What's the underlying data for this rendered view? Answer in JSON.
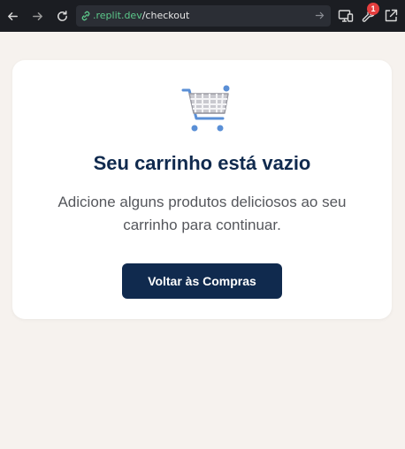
{
  "browser": {
    "url_host": ".replit.dev",
    "url_path": "/checkout",
    "notification_count": "1"
  },
  "cart": {
    "title": "Seu carrinho está vazio",
    "message": "Adicione alguns produtos deliciosos ao seu carrinho para continuar.",
    "button_label": "Voltar às Compras"
  },
  "icons": [
    "back-arrow-icon",
    "forward-arrow-icon",
    "reload-icon",
    "link-icon",
    "go-arrow-icon",
    "devices-icon",
    "wrench-icon",
    "external-link-icon",
    "shopping-cart-icon"
  ],
  "colors": {
    "page_background": "#f6f2ee",
    "card_background": "#ffffff",
    "primary": "#102a4e",
    "browser_bar": "#1b1d22",
    "url_host": "#5cc98b",
    "badge": "#e53e3e"
  }
}
